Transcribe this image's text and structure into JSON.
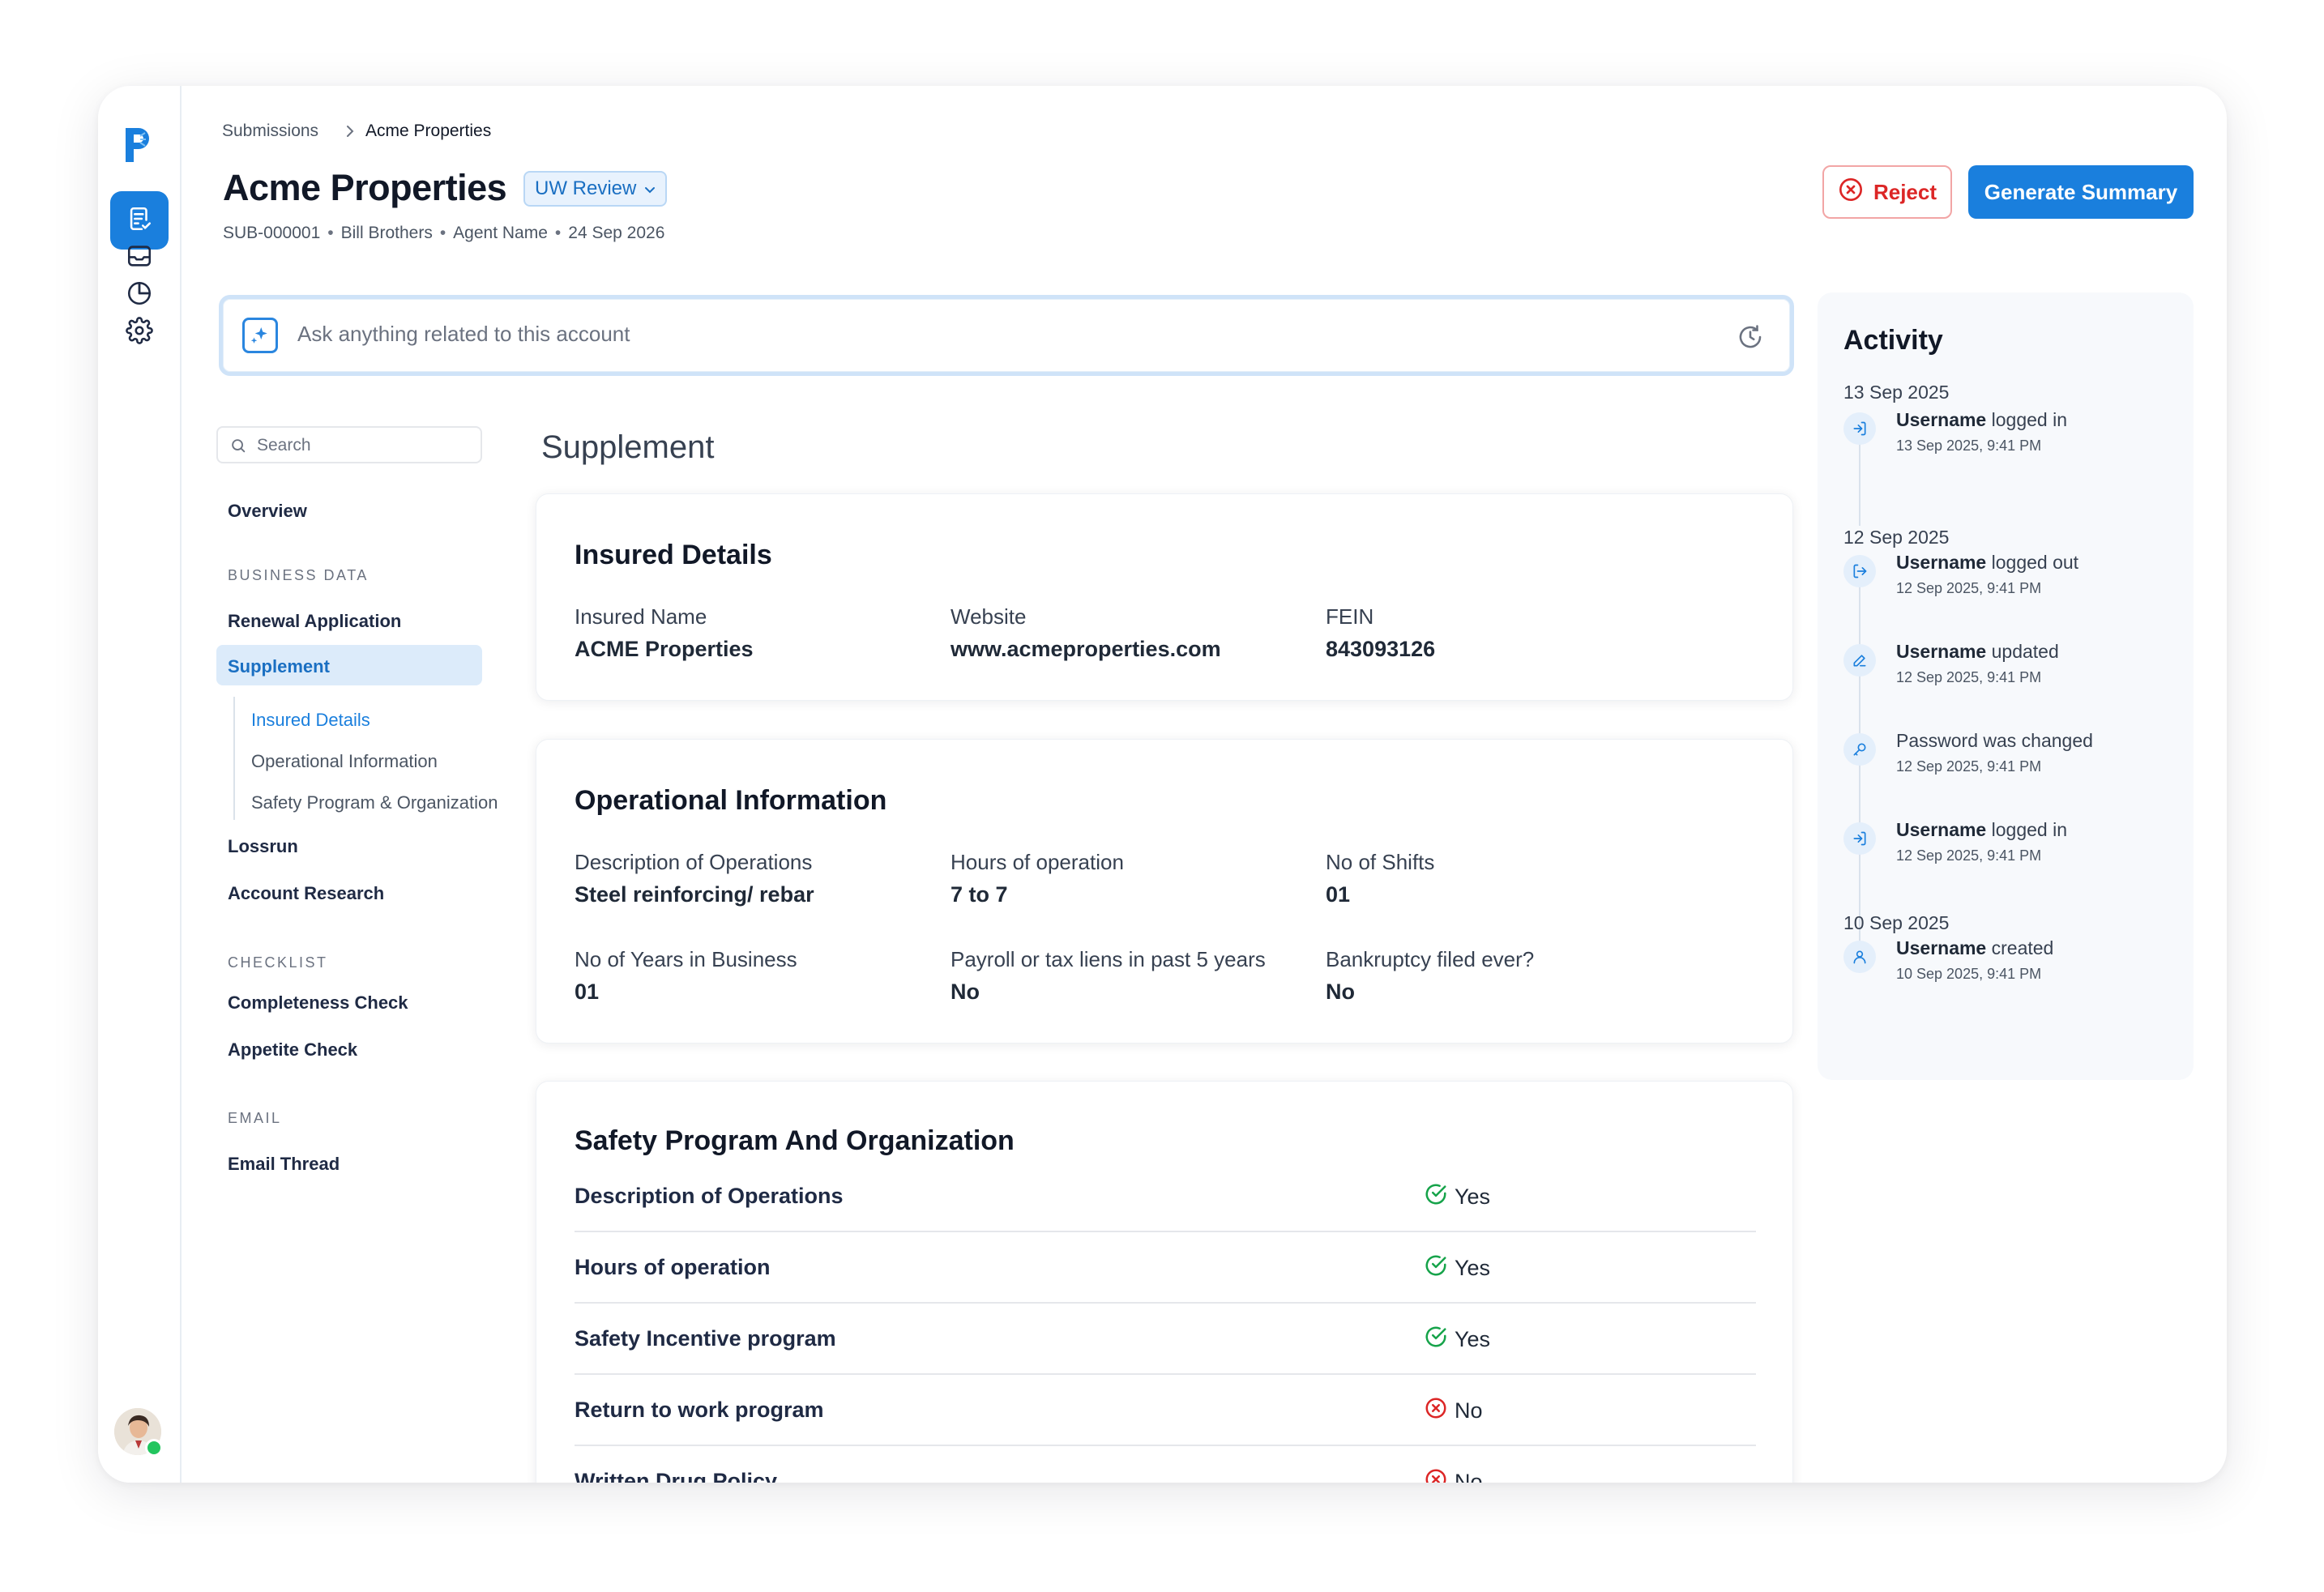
{
  "breadcrumb": {
    "parent": "Submissions",
    "current": "Acme Properties"
  },
  "header": {
    "title": "Acme Properties",
    "status": "UW Review",
    "submission_id": "SUB-000001",
    "broker": "Bill Brothers",
    "agent": "Agent Name",
    "date": "24 Sep 2026",
    "reject_label": "Reject",
    "generate_label": "Generate Summary"
  },
  "ask": {
    "placeholder": "Ask anything related to this account"
  },
  "subnav": {
    "search_placeholder": "Search",
    "overview": "Overview",
    "business_heading": "BUSINESS DATA",
    "renewal": "Renewal Application",
    "supplement": "Supplement",
    "sub_items": [
      "Insured Details",
      "Operational Information",
      "Safety Program & Organization"
    ],
    "lossrun": "Lossrun",
    "account_research": "Account Research",
    "checklist_heading": "CHECKLIST",
    "completeness": "Completeness Check",
    "appetite": "Appetite Check",
    "email_heading": "EMAIL",
    "email_thread": "Email Thread"
  },
  "content": {
    "section_title": "Supplement",
    "insured": {
      "title": "Insured Details",
      "fields": [
        {
          "label": "Insured Name",
          "value": "ACME Properties"
        },
        {
          "label": "Website",
          "value": "www.acmeproperties.com"
        },
        {
          "label": "FEIN",
          "value": "843093126"
        }
      ]
    },
    "operational": {
      "title": "Operational Information",
      "fields": [
        {
          "label": "Description of Operations",
          "value": "Steel reinforcing/ rebar"
        },
        {
          "label": "Hours of operation",
          "value": "7 to 7"
        },
        {
          "label": "No of Shifts",
          "value": "01"
        },
        {
          "label": "No of Years in Business",
          "value": "01"
        },
        {
          "label": "Payroll or tax liens in past 5 years",
          "value": "No"
        },
        {
          "label": "Bankruptcy filed ever?",
          "value": "No"
        }
      ]
    },
    "safety": {
      "title": "Safety Program And Organization",
      "rows": [
        {
          "label": "Description of Operations",
          "value": "Yes",
          "ok": true
        },
        {
          "label": "Hours of operation",
          "value": "Yes",
          "ok": true
        },
        {
          "label": "Safety Incentive program",
          "value": "Yes",
          "ok": true
        },
        {
          "label": "Return to work program",
          "value": "No",
          "ok": false
        },
        {
          "label": "Written Drug Policy",
          "value": "No",
          "ok": false
        }
      ]
    }
  },
  "activity": {
    "title": "Activity",
    "groups": [
      {
        "date": "13 Sep 2025",
        "items": [
          {
            "icon": "login-icon",
            "user": "Username",
            "action": "logged in",
            "time": "13 Sep 2025, 9:41 PM"
          }
        ]
      },
      {
        "date": "12 Sep 2025",
        "items": [
          {
            "icon": "logout-icon",
            "user": "Username",
            "action": "logged out",
            "time": "12 Sep 2025, 9:41 PM"
          },
          {
            "icon": "edit-icon",
            "user": "Username",
            "action": "updated",
            "time": "12 Sep 2025, 9:41 PM"
          },
          {
            "icon": "key-icon",
            "user": "",
            "action": "Password was changed",
            "time": "12 Sep 2025, 9:41 PM"
          },
          {
            "icon": "login-icon",
            "user": "Username",
            "action": "logged in",
            "time": "12 Sep 2025, 9:41 PM"
          }
        ]
      },
      {
        "date": "10 Sep 2025",
        "items": [
          {
            "icon": "user-icon",
            "user": "Username",
            "action": "created",
            "time": "10 Sep 2025, 9:41 PM"
          }
        ]
      }
    ]
  },
  "colors": {
    "accent": "#1a7fdd",
    "danger": "#dc2626",
    "success": "#16a34a"
  }
}
